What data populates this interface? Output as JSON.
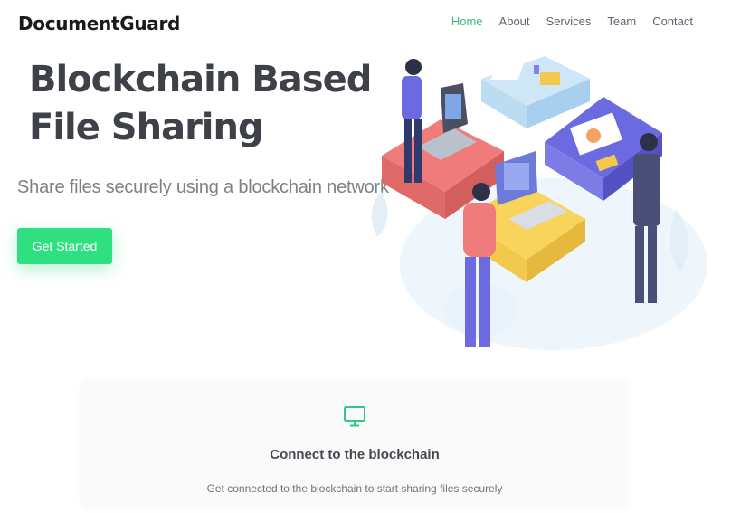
{
  "header": {
    "brand": "DocumentGuard",
    "nav": [
      {
        "label": "Home",
        "active": true
      },
      {
        "label": "About",
        "active": false
      },
      {
        "label": "Services",
        "active": false
      },
      {
        "label": "Team",
        "active": false
      },
      {
        "label": "Contact",
        "active": false
      }
    ]
  },
  "hero": {
    "title_line1": "Blockchain Based",
    "title_line2": "File Sharing",
    "subtitle": "Share files securely using a blockchain network",
    "cta_label": "Get Started",
    "illustration": "blockchain-teamwork-illustration"
  },
  "feature": {
    "icon": "monitor-icon",
    "title": "Connect to the blockchain",
    "text": "Get connected to the blockchain to start sharing files securely"
  },
  "colors": {
    "accent": "#2ee07f",
    "nav_active": "#3bb97a",
    "title": "#3f4148"
  }
}
